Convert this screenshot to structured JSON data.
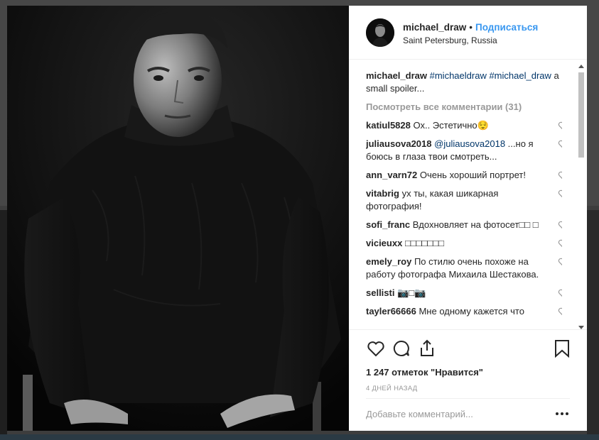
{
  "post": {
    "username": "michael_draw",
    "separator": "•",
    "follow_label": "Подписаться",
    "location": "Saint Petersburg, Russia",
    "caption": {
      "username": "michael_draw",
      "tag1": "#michaeldraw",
      "tag2": "#michael_draw",
      "text": " a small spoiler..."
    },
    "view_all": "Посмотреть все комментарии (31)",
    "comments": [
      {
        "user": "katiul5828",
        "text": "Ох.. Эстетично😌"
      },
      {
        "user": "juliausova2018",
        "mention": "@juliausova2018",
        "text": " ...но я боюсь в глаза твои смотреть..."
      },
      {
        "user": "ann_varn72",
        "text": "Очень хороший портрет!"
      },
      {
        "user": "vitabrig",
        "text": "ух ты, какая шикарная фотография!"
      },
      {
        "user": "sofi_franc",
        "text": "Вдохновляет на фотосет□□ □"
      },
      {
        "user": "vicieuxx",
        "text": "□□□□□□□"
      },
      {
        "user": "emely_roy",
        "text": "По стилю очень похоже на работу фотографа Михаила Шестакова."
      },
      {
        "user": "sellisti",
        "text": "📷□📷"
      },
      {
        "user": "tayler66666",
        "text": "Мне одному кажется что"
      }
    ],
    "likes": "1 247 отметок \"Нравится\"",
    "time": "4 ДНЕЙ НАЗАД",
    "comment_placeholder": "Добавьте комментарий..."
  },
  "icons": {
    "like": "heart-icon",
    "comment": "comment-icon",
    "share": "share-icon",
    "save": "bookmark-icon",
    "more": "more-icon"
  },
  "colors": {
    "accent": "#3897f0",
    "hashtag": "#003569",
    "muted": "#999999",
    "text": "#262626"
  }
}
